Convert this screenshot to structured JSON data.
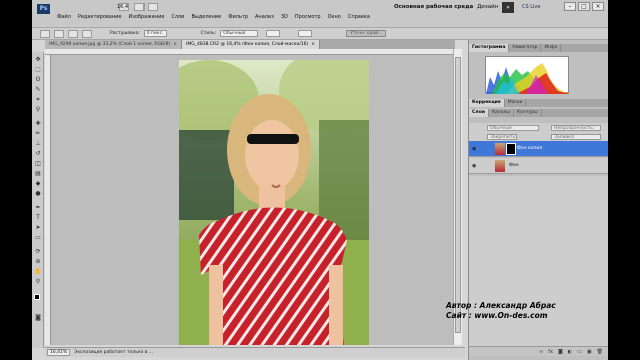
{
  "menu": {
    "logo": "Ps",
    "zoom": "16,4",
    "items": [
      "Файл",
      "Редактирование",
      "Изображение",
      "Слои",
      "Выделение",
      "Фильтр",
      "Анализ",
      "3D",
      "Просмотр",
      "Окно",
      "Справка"
    ],
    "workspace": "Основная рабочая среда",
    "design": "Дизайн",
    "workspace_arrow": "»",
    "cs_live": "CS Live"
  },
  "options": {
    "feather_label": "Растушевка:",
    "feather_value": "0 пикс.",
    "style_label": "Стиль:",
    "style_value": "Обычный",
    "refine_button": "Уточн. край..."
  },
  "tabs": [
    {
      "label": "IMG_9298 копия.jpg @ 33,2% (Слой 1 копия, RGB/8)",
      "close": "×"
    },
    {
      "label": "IMG_4838.CR2 @ 16,4% (Фон копия, Слой-маска/16)",
      "close": "×"
    }
  ],
  "status": {
    "zoom": "16,41%",
    "text": "Экспозиция работает только в ..."
  },
  "panels": {
    "top_tabs": [
      "Гистограмма",
      "Навигатор",
      "Инфо"
    ],
    "adjust_tabs": [
      "Коррекция",
      "Маски"
    ],
    "layers_tabs": [
      "Слои",
      "Каналы",
      "Контуры"
    ],
    "blend_mode": "Обычные",
    "opacity_label": "Непрозрачность:",
    "lock_label": "Закрепить:",
    "fill_label": "Заливка:",
    "layers": [
      {
        "name": "Фон копия",
        "selected": true
      },
      {
        "name": "Фон",
        "selected": false
      }
    ],
    "eye_icon": "◉"
  },
  "credit": {
    "line1": "Автор : Александр Абрас",
    "line2": "Сайт : www.On-des.com"
  }
}
